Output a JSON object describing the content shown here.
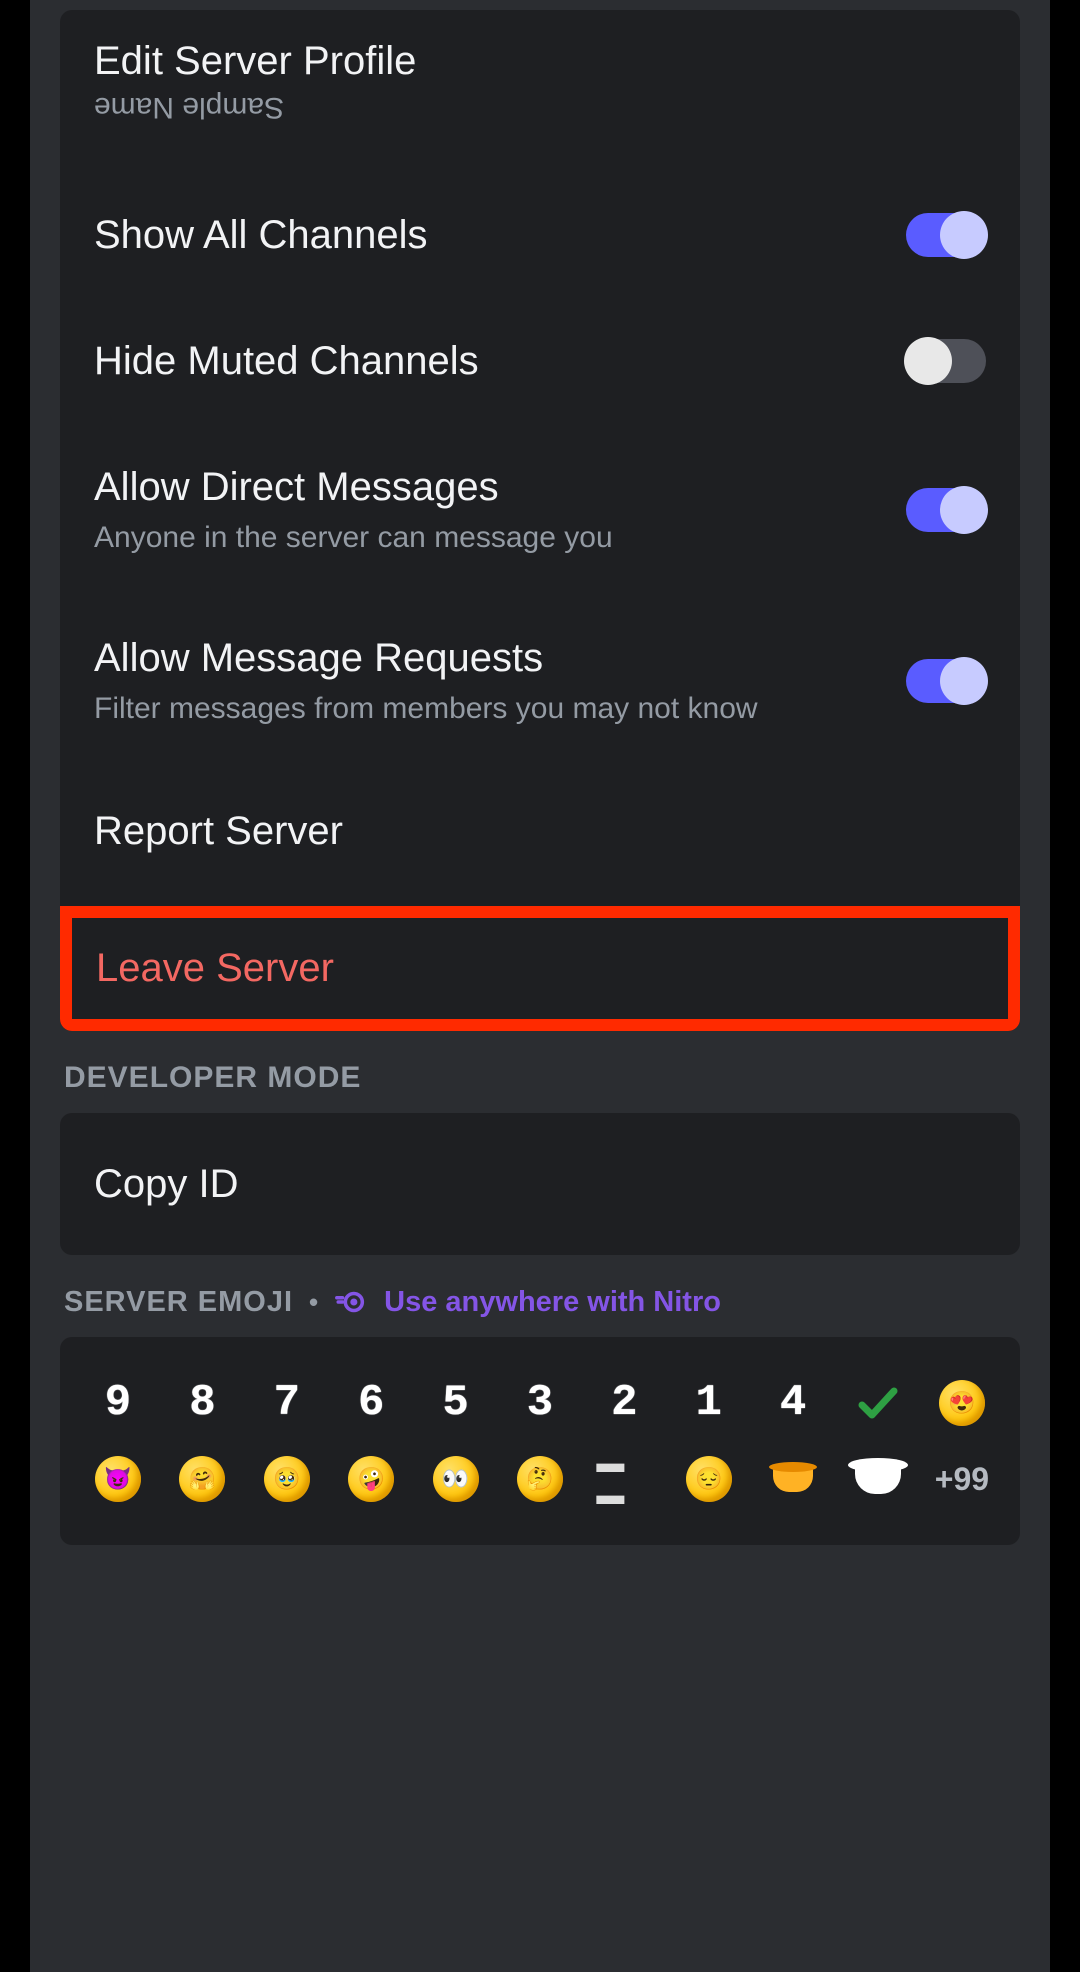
{
  "settings": {
    "edit_profile": {
      "title": "Edit Server Profile",
      "sub_flipped": "Sample Name"
    },
    "show_all_channels": {
      "title": "Show All Channels",
      "on": true
    },
    "hide_muted": {
      "title": "Hide Muted Channels",
      "on": false
    },
    "allow_dm": {
      "title": "Allow Direct Messages",
      "sub": "Anyone in the server can message you",
      "on": true
    },
    "allow_msg_req": {
      "title": "Allow Message Requests",
      "sub": "Filter messages from members you may not know",
      "on": true
    },
    "report": {
      "title": "Report Server"
    },
    "leave": {
      "title": "Leave Server"
    }
  },
  "dev_mode": {
    "header": "DEVELOPER MODE",
    "copy_id": "Copy ID"
  },
  "emoji_section": {
    "header": "SERVER EMOJI",
    "nitro_text": "Use anywhere with Nitro",
    "row1": [
      "9",
      "8",
      "7",
      "6",
      "5",
      "3",
      "2",
      "1",
      "4",
      "check",
      "face-hearteyes"
    ],
    "row2": [
      "face-chomp",
      "face-shy",
      "face-tear",
      "face-goofy",
      "face-look",
      "face-hmm",
      "dashes",
      "face-sad",
      "teacup-orange",
      "teacup-white",
      "more"
    ],
    "more_label": "+99"
  }
}
